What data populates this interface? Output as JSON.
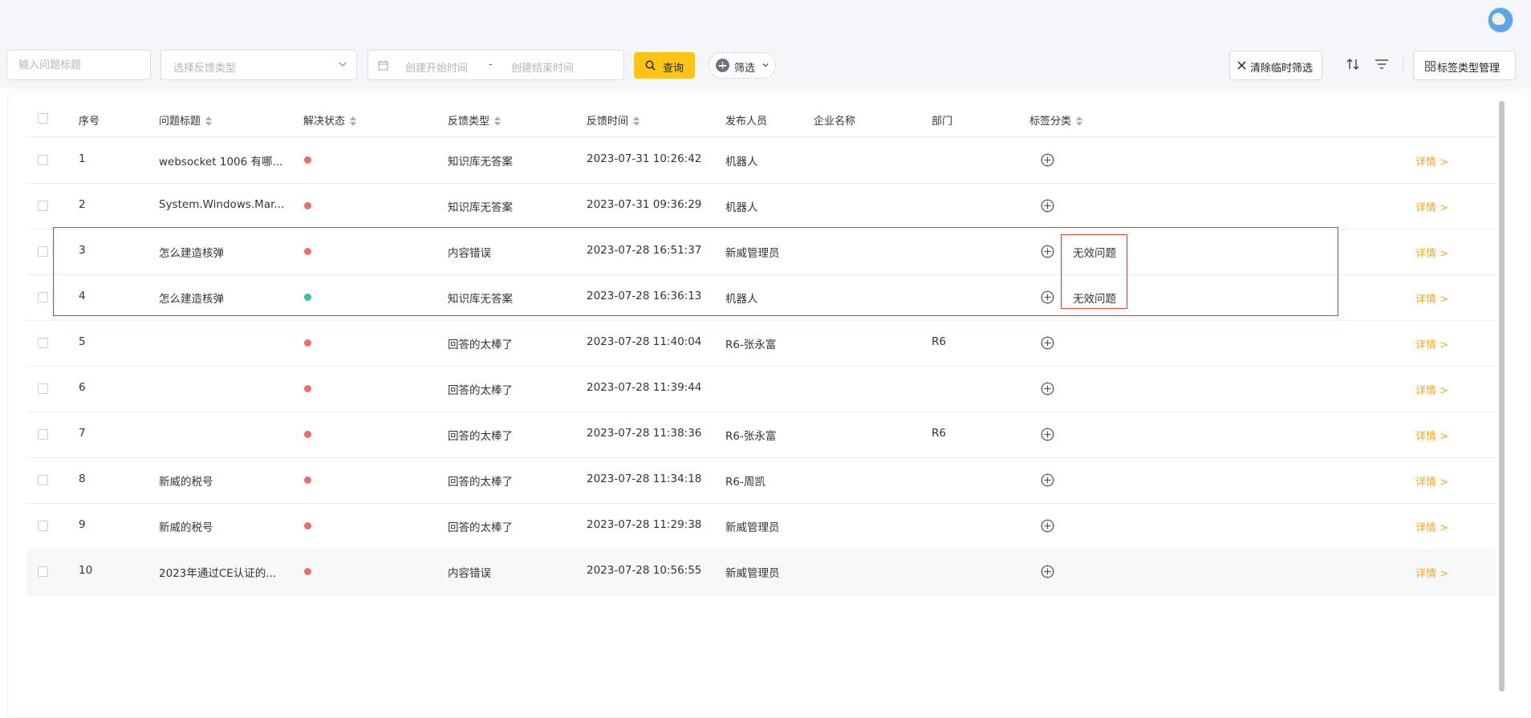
{
  "header": {
    "avatar_icon": "user-avatar"
  },
  "filters": {
    "title_placeholder": "输入问题标题",
    "type_placeholder": "选择反馈类型",
    "start_placeholder": "创建开始时间",
    "date_separator": "-",
    "end_placeholder": "创建结束时间",
    "query_label": "查询",
    "filter_label": "筛选",
    "clear_label": "清除临时筛选",
    "tag_manage_label": "标签类型管理"
  },
  "colors": {
    "accent": "#ffc414",
    "status_unresolved": "#f06b6b",
    "status_resolved": "#2cc7a8",
    "detail_link": "#f5a623",
    "highlight": "#e53935"
  },
  "table": {
    "columns": [
      "序号",
      "问题标题",
      "解决状态",
      "反馈类型",
      "反馈时间",
      "发布人员",
      "企业名称",
      "部门",
      "标签分类"
    ],
    "detail_label": "详情 >",
    "rows": [
      {
        "index": "1",
        "title": "websocket 1006 有哪...",
        "status": "unresolved",
        "type": "知识库无答案",
        "time": "2023-07-31 10:26:42",
        "publisher": "机器人",
        "company": "",
        "dept": "",
        "tag": ""
      },
      {
        "index": "2",
        "title": "System.Windows.Mar...",
        "status": "unresolved",
        "type": "知识库无答案",
        "time": "2023-07-31 09:36:29",
        "publisher": "机器人",
        "company": "",
        "dept": "",
        "tag": ""
      },
      {
        "index": "3",
        "title": "怎么建造核弹",
        "status": "unresolved",
        "type": "内容错误",
        "time": "2023-07-28 16:51:37",
        "publisher": "新威管理员",
        "company": "",
        "dept": "",
        "tag": "无效问题"
      },
      {
        "index": "4",
        "title": "怎么建造核弹",
        "status": "resolved",
        "type": "知识库无答案",
        "time": "2023-07-28 16:36:13",
        "publisher": "机器人",
        "company": "",
        "dept": "",
        "tag": "无效问题"
      },
      {
        "index": "5",
        "title": "",
        "status": "unresolved",
        "type": "回答的太棒了",
        "time": "2023-07-28 11:40:04",
        "publisher": "R6-张永富",
        "company": "",
        "dept": "R6",
        "tag": ""
      },
      {
        "index": "6",
        "title": "",
        "status": "unresolved",
        "type": "回答的太棒了",
        "time": "2023-07-28 11:39:44",
        "publisher": "",
        "company": "",
        "dept": "",
        "tag": ""
      },
      {
        "index": "7",
        "title": "",
        "status": "unresolved",
        "type": "回答的太棒了",
        "time": "2023-07-28 11:38:36",
        "publisher": "R6-张永富",
        "company": "",
        "dept": "R6",
        "tag": ""
      },
      {
        "index": "8",
        "title": "新威的税号",
        "status": "unresolved",
        "type": "回答的太棒了",
        "time": "2023-07-28 11:34:18",
        "publisher": "R6-周凯",
        "company": "",
        "dept": "",
        "tag": ""
      },
      {
        "index": "9",
        "title": "新威的税号",
        "status": "unresolved",
        "type": "回答的太棒了",
        "time": "2023-07-28 11:29:38",
        "publisher": "新威管理员",
        "company": "",
        "dept": "",
        "tag": ""
      },
      {
        "index": "10",
        "title": "2023年通过CE认证的...",
        "status": "unresolved",
        "type": "内容错误",
        "time": "2023-07-28 10:56:55",
        "publisher": "新威管理员",
        "company": "",
        "dept": "",
        "tag": ""
      }
    ]
  }
}
